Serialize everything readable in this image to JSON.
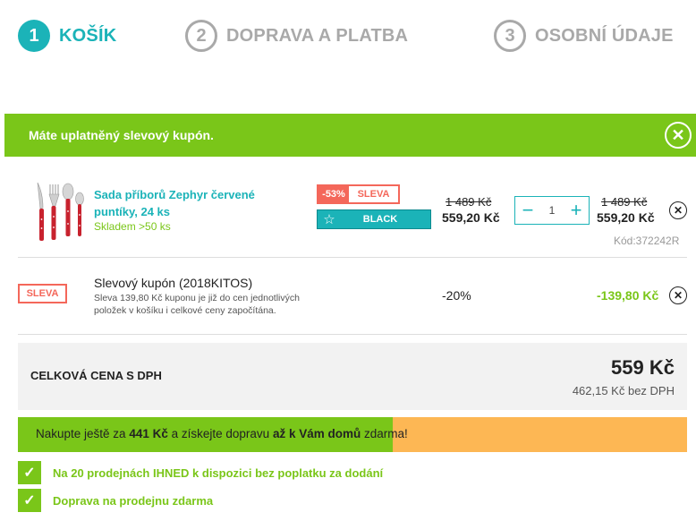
{
  "steps": [
    {
      "number": "1",
      "label": "KOŠÍK"
    },
    {
      "number": "2",
      "label": "DOPRAVA A PLATBA"
    },
    {
      "number": "3",
      "label": "OSOBNÍ ÚDAJE"
    }
  ],
  "banner": {
    "text": "Máte uplatněný slevový kupón.",
    "close": "✕"
  },
  "product": {
    "name": "Sada příborů Zephyr červené puntíky, 24 ks",
    "stock": "Skladem >50 ks",
    "badge_pct": "-53%",
    "badge_sale": "SLEVA",
    "badge_black": "BLACK",
    "unit_price_old": "1 489 Kč",
    "unit_price_new": "559,20 Kč",
    "qty_minus": "−",
    "qty_value": "1",
    "qty_plus": "+",
    "total_old": "1 489 Kč",
    "total_new": "559,20 Kč",
    "code": "Kód:372242R"
  },
  "coupon": {
    "tag": "SLEVA",
    "name": "Slevový kupón (2018KITOS)",
    "desc": "Sleva 139,80 Kč kuponu je již do cen jednotlivých položek v košíku i celkové ceny započítána.",
    "pct": "-20%",
    "amount": "-139,80 Kč"
  },
  "total": {
    "label": "CELKOVÁ CENA S DPH",
    "price": "559 Kč",
    "ex_vat": "462,15 Kč bez DPH"
  },
  "shipping": {
    "progress": 0.56,
    "t1": "Nakupte ještě za ",
    "amount": "441 Kč",
    "t2": " a získejte dopravu ",
    "where": "až k Vám domů",
    "t3": " zdarma!"
  },
  "benefits": [
    "Na 20 prodejnách IHNED k dispozici bez poplatku za dodání",
    "Doprava na prodejnu zdarma"
  ],
  "colors": {
    "accent": "#1bb3b8",
    "green": "#7ac619",
    "sale": "#f4675a",
    "orange": "#fdb754"
  },
  "icons": {
    "remove": "close-circle-icon",
    "check": "check-icon",
    "star": "star-icon"
  }
}
